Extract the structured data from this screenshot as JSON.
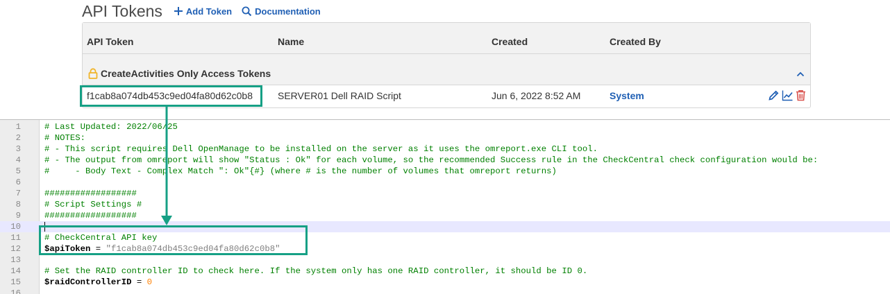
{
  "header": {
    "title": "API Tokens",
    "add_token": "Add Token",
    "documentation": "Documentation"
  },
  "table": {
    "columns": [
      "API Token",
      "Name",
      "Created",
      "Created By"
    ],
    "group_label": "CreateActivities Only Access Tokens",
    "rows": [
      {
        "token": "f1cab8a074db453c9ed04fa80d62c0b8",
        "name": "SERVER01 Dell RAID Script",
        "created": "Jun 6, 2022 8:52 AM",
        "created_by": "System"
      }
    ]
  },
  "editor": {
    "lines": [
      {
        "n": "1",
        "comment": "# Last Updated: 2022/06/25"
      },
      {
        "n": "2",
        "comment": "# NOTES:"
      },
      {
        "n": "3",
        "comment": "# - This script requires Dell OpenManage to be installed on the server as it uses the omreport.exe CLI tool."
      },
      {
        "n": "4",
        "comment": "# - The output from omreport will show \"Status : Ok\" for each volume, so the recommended Success rule in the CheckCentral check configuration would be:"
      },
      {
        "n": "5",
        "comment": "#     - Body Text - Complex Match \": Ok\"{#} (where # is the number of volumes that omreport returns)"
      },
      {
        "n": "6",
        "comment": ""
      },
      {
        "n": "7",
        "comment": "##################"
      },
      {
        "n": "8",
        "comment": "# Script Settings #"
      },
      {
        "n": "9",
        "comment": "##################"
      },
      {
        "n": "10",
        "comment": ""
      },
      {
        "n": "11",
        "comment": "# CheckCentral API key"
      },
      {
        "n": "12",
        "var": "$apiToken",
        "op": " = ",
        "str": "\"f1cab8a074db453c9ed04fa80d62c0b8\""
      },
      {
        "n": "13",
        "comment": ""
      },
      {
        "n": "14",
        "comment": "# Set the RAID controller ID to check here. If the system only has one RAID controller, it should be ID 0."
      },
      {
        "n": "15",
        "var": "$raidControllerID",
        "op": " = ",
        "num": "0"
      },
      {
        "n": "16",
        "comment": ""
      }
    ]
  },
  "colors": {
    "accent": "#16a085",
    "link": "#1f5fb4",
    "delete": "#d9534f",
    "lock": "#f0b429",
    "comment": "#008000",
    "string": "#808080",
    "number": "#ff8000"
  },
  "icons": [
    "plus-icon",
    "search-icon",
    "lock-icon",
    "chevron-up-icon",
    "pencil-icon",
    "chart-line-icon",
    "trash-icon",
    "arrow-icon"
  ]
}
